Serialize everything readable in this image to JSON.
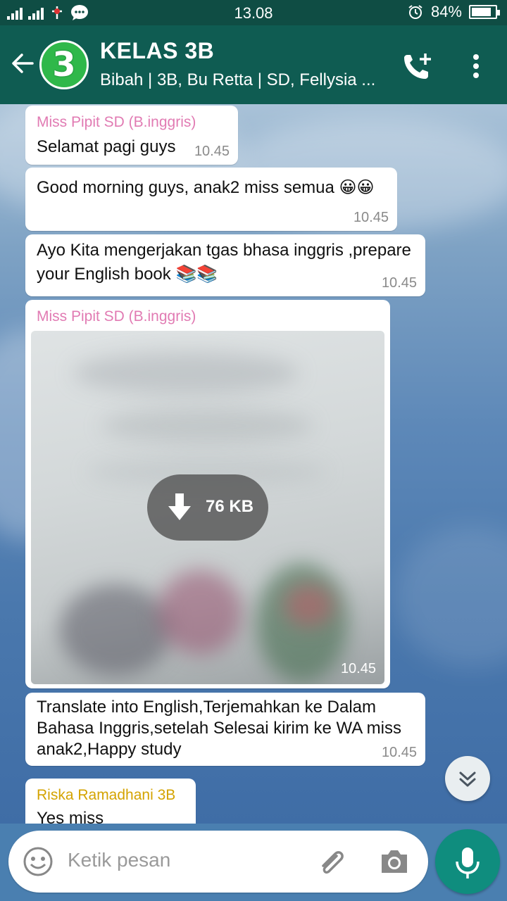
{
  "status_bar": {
    "time": "13.08",
    "battery": "84%",
    "battery_level": 0.84
  },
  "header": {
    "avatar_text": "3",
    "title": "KELAS 3B",
    "subtitle": "Bibah | 3B, Bu Retta | SD, Fellysia ..."
  },
  "messages": [
    {
      "sender": "Miss Pipit SD (B.inggris)",
      "lines": [
        "Selamat pagi guys"
      ],
      "time": "10.45"
    },
    {
      "lines": [
        "Good morning guys, anak2 miss semua 😀😀"
      ],
      "time": "10.45"
    },
    {
      "lines": [
        "Ayo Kita mengerjakan tgas bhasa inggris ,prepare",
        "your English book 📚📚"
      ],
      "time": "10.45"
    },
    {
      "sender": "Miss Pipit SD (B.inggris)",
      "image_size": "76 KB",
      "time": "10.45"
    },
    {
      "lines": [
        "Translate into English,Terjemahkan ke Dalam",
        "Bahasa Inggris,setelah Selesai kirim ke WA miss",
        "anak2,Happy study"
      ],
      "time": "10.45"
    },
    {
      "sender": "Riska Ramadhani 3B",
      "lines": [
        "Yes miss"
      ]
    }
  ],
  "colors": {
    "header_bg": "#0f5c52",
    "sender_pink": "#e17bb3",
    "sender_yellow": "#d4a300",
    "mic_green": "#0f8d7e"
  },
  "input": {
    "placeholder": "Ketik pesan"
  },
  "icons": {
    "back": "arrow-left-icon",
    "add_call": "phone-add-icon",
    "menu": "more-vert-icon",
    "download": "download-arrow-icon",
    "scroll": "double-chevron-down-icon",
    "emoji": "emoji-icon",
    "attach": "paperclip-icon",
    "camera": "camera-icon",
    "mic": "microphone-icon"
  }
}
